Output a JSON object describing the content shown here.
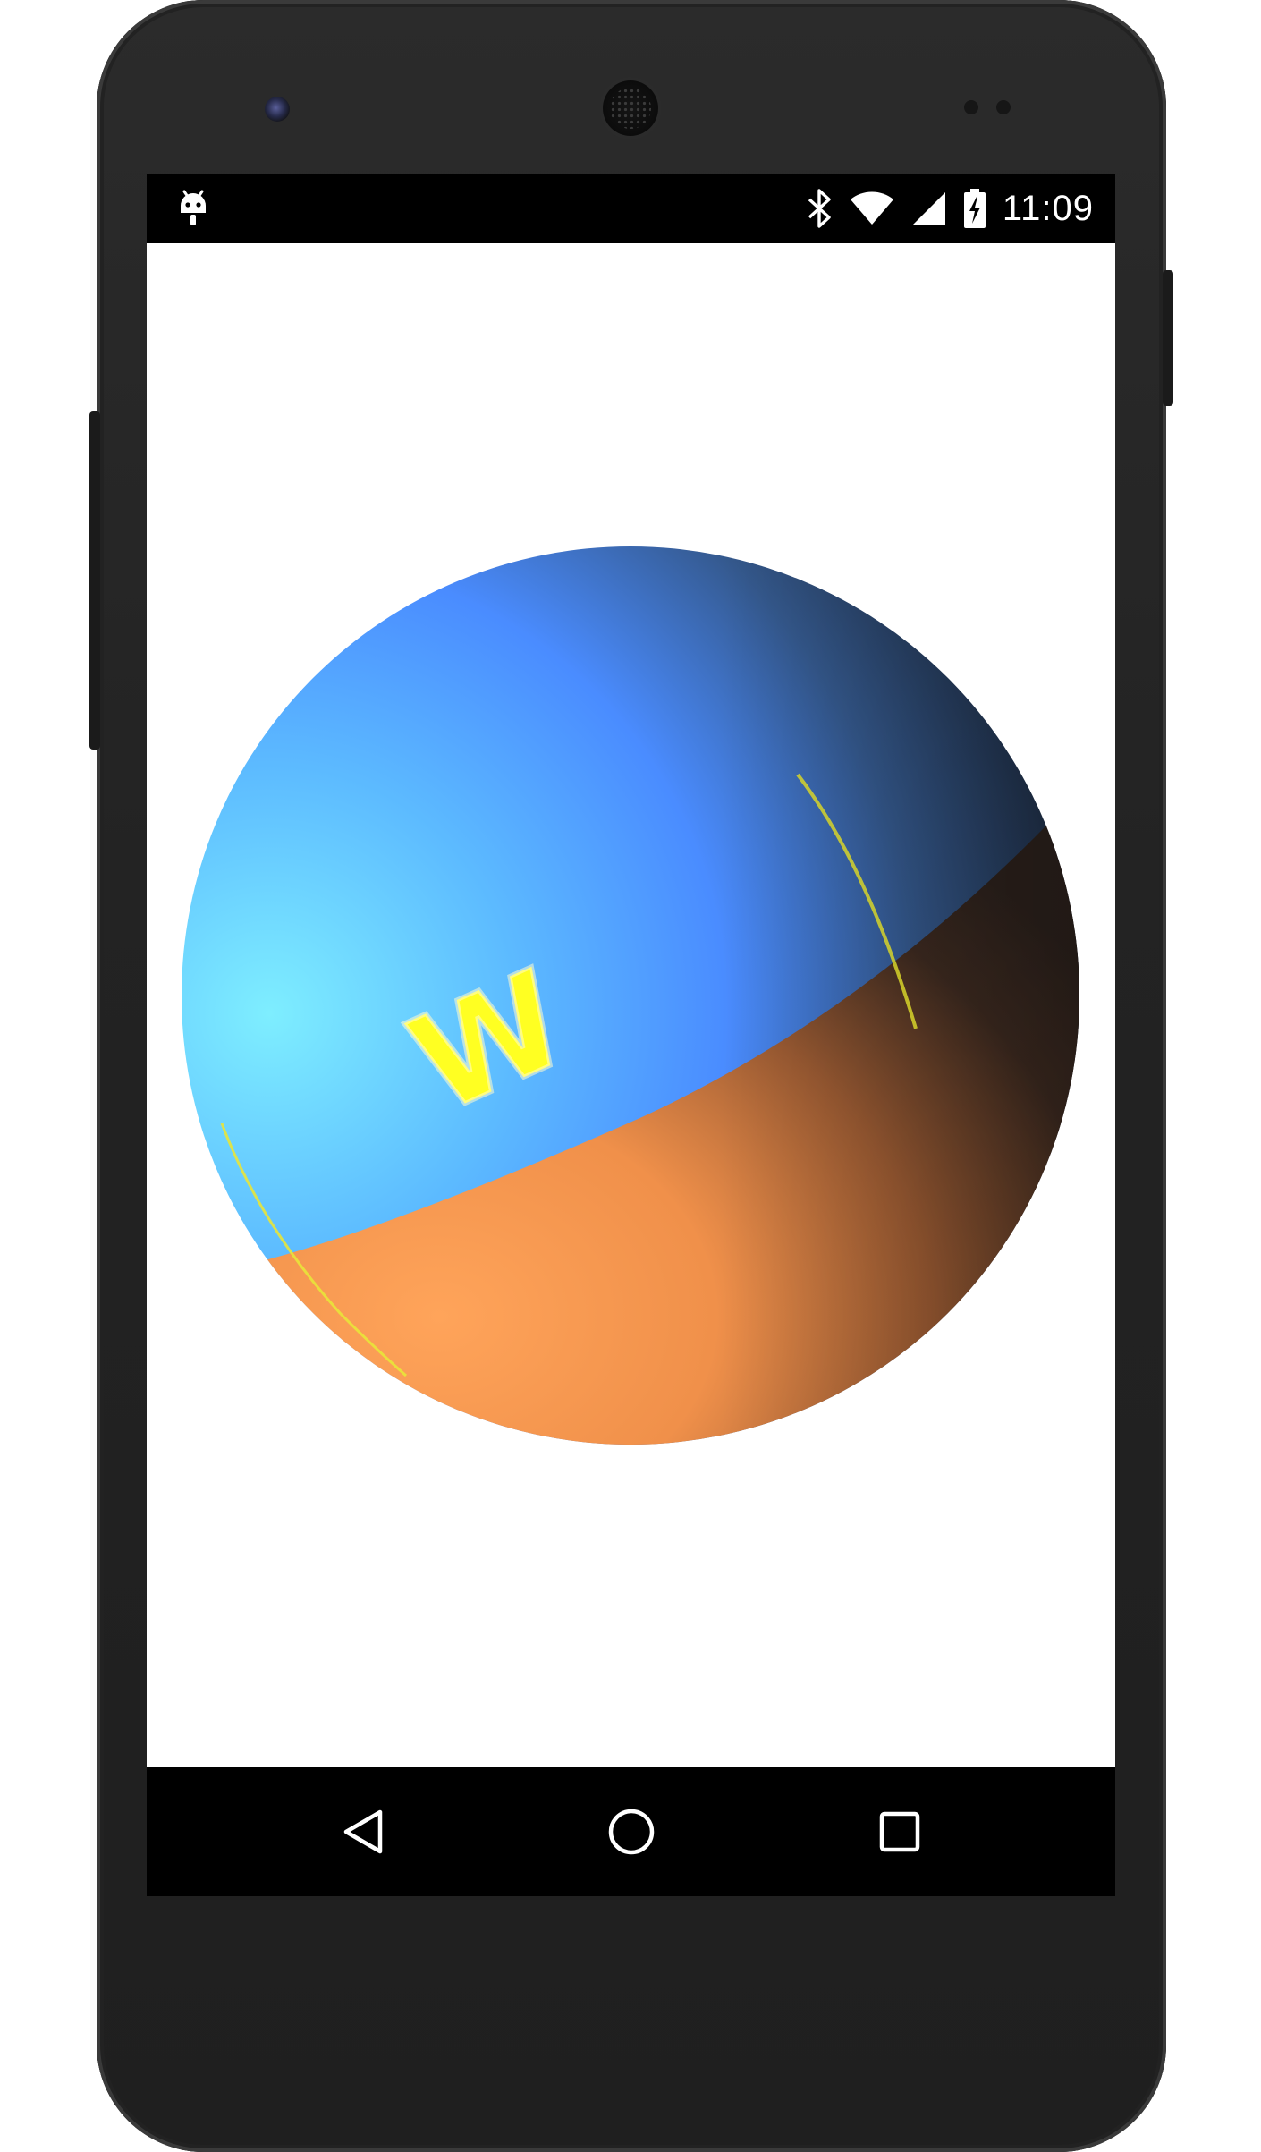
{
  "status_bar": {
    "time": "11:09",
    "notification_icon": "android-debug-icon",
    "icons": [
      "bluetooth-icon",
      "wifi-icon",
      "cell-signal-icon",
      "battery-charging-icon"
    ]
  },
  "scene": {
    "object": "sphere",
    "label": "W",
    "colors": {
      "upper_hemisphere": "#5aa8ff",
      "lower_hemisphere": "#f0904a",
      "label_color": "#ffff33",
      "background": "#ffffff"
    }
  },
  "nav_bar": {
    "buttons": [
      "back-icon",
      "home-icon",
      "recent-apps-icon"
    ]
  },
  "colors": {
    "device_body": "#262626",
    "status_bar_bg": "#000000",
    "nav_bar_bg": "#000000"
  }
}
